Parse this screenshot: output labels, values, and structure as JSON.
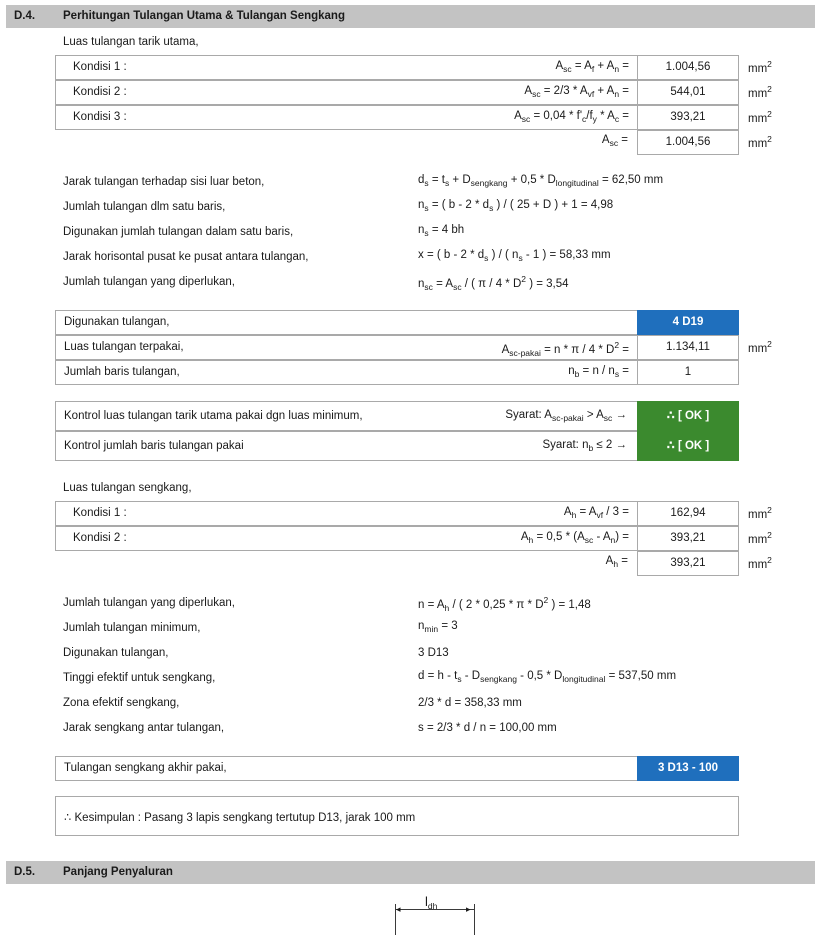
{
  "section_d4": {
    "number": "D.4.",
    "title": "Perhitungan Tulangan Utama & Tulangan Sengkang"
  },
  "main_area": {
    "heading": "Luas tulangan tarik utama,",
    "rows": [
      {
        "label": "Kondisi 1 :",
        "value": "1.004,56"
      },
      {
        "label": "Kondisi 2 :",
        "value": "544,01"
      },
      {
        "label": "Kondisi 3 :",
        "value": "393,21"
      }
    ],
    "result_value": "1.004,56",
    "unit": "mm"
  },
  "calc_lines": [
    {
      "label": "Jarak tulangan terhadap sisi luar beton,",
      "value": "= 62,50 mm"
    },
    {
      "label": "Jumlah tulangan dlm satu baris,",
      "value": "n = ( b - 2 * d ) / ( 25 + D ) + 1 = 4,98"
    },
    {
      "label": "Digunakan jumlah tulangan dalam satu baris,",
      "value": "= 4 bh"
    },
    {
      "label": "Jarak horisontal pusat ke pusat antara tulangan,",
      "value": "x = ( b - 2 * d ) / ( n - 1 ) = 58,33 mm"
    },
    {
      "label": "Jumlah tulangan yang diperlukan,",
      "value": "= A / ( π / 4 * D ) = 3,54"
    }
  ],
  "used_bars": {
    "rows": [
      {
        "label": "Digunakan tulangan,",
        "value": "4 D19"
      },
      {
        "label": "Luas tulangan terpakai,",
        "value": "1.134,11"
      },
      {
        "label": "Jumlah baris tulangan,",
        "value": "1"
      }
    ]
  },
  "controls": [
    {
      "label": "Kontrol luas tulangan tarik utama pakai dgn luas minimum,",
      "syarat": "Syarat:",
      "status": "∴ [ OK ]"
    },
    {
      "label": "Kontrol jumlah baris tulangan pakai",
      "syarat": "Syarat:",
      "status": "∴ [ OK ]"
    }
  ],
  "stirrup_area": {
    "heading": "Luas tulangan sengkang,",
    "rows": [
      {
        "label": "Kondisi 1 :",
        "value": "162,94"
      },
      {
        "label": "Kondisi 2 :",
        "value": "393,21"
      }
    ],
    "result_value": "393,21"
  },
  "stirrup_lines": [
    {
      "label": "Jumlah tulangan yang diperlukan,",
      "value": "/ ( 2 * 0,25 * π * D ) = 1,48"
    },
    {
      "label": "Jumlah tulangan minimum,",
      "value": "= 3"
    },
    {
      "label": "Digunakan tulangan,",
      "value": "3 D13"
    },
    {
      "label": "Tinggi efektif untuk sengkang,",
      "value": "= 537,50 mm"
    },
    {
      "label": "Zona efektif sengkang,",
      "value": "2/3 * d = 358,33 mm"
    },
    {
      "label": "Jarak sengkang antar tulangan,",
      "value": "s = 2/3 * d / n = 100,00 mm"
    }
  ],
  "final_stirrup": {
    "label": "Tulangan sengkang akhir pakai,",
    "value": "3 D13 - 100"
  },
  "conclusion": "∴ Kesimpulan : Pasang 3 lapis sengkang tertutup D13, jarak 100 mm",
  "section_d5": {
    "number": "D.5.",
    "title": "Panjang Penyaluran"
  },
  "diagram_label": "dh",
  "colors": {
    "header_gray": "#c3c3c3",
    "accent_blue": "#1f6fbd",
    "ok_green": "#3b8a2e"
  }
}
